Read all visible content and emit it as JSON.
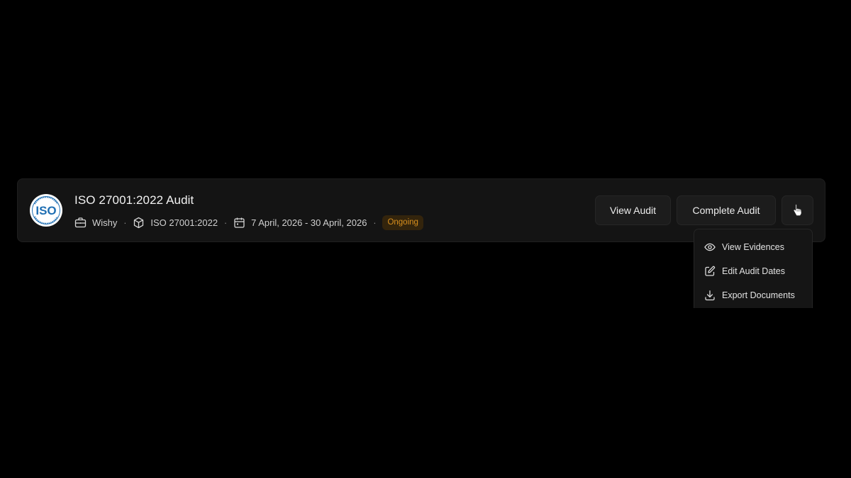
{
  "audit": {
    "logo_text": "ISO",
    "logo_icon": "iso-logo",
    "title": "ISO 27001:2022 Audit",
    "company": "Wishy",
    "framework": "ISO 27001:2022",
    "date_range": "7 April, 2026 - 30 April, 2026",
    "separator": "·",
    "status": "Ongoing",
    "status_color": "#d88f1e"
  },
  "actions": {
    "view_audit": "View Audit",
    "complete_audit": "Complete Audit",
    "more_icon": "pointer-hand-icon"
  },
  "menu": {
    "items": [
      {
        "label": "View Evidences",
        "icon": "eye-icon"
      },
      {
        "label": "Edit Audit Dates",
        "icon": "edit-icon"
      },
      {
        "label": "Export Documents",
        "icon": "download-icon"
      }
    ]
  },
  "colors": {
    "background": "#000000",
    "card": "#141414",
    "button": "#1c1c1c",
    "brand_blue": "#1f6fb3"
  }
}
